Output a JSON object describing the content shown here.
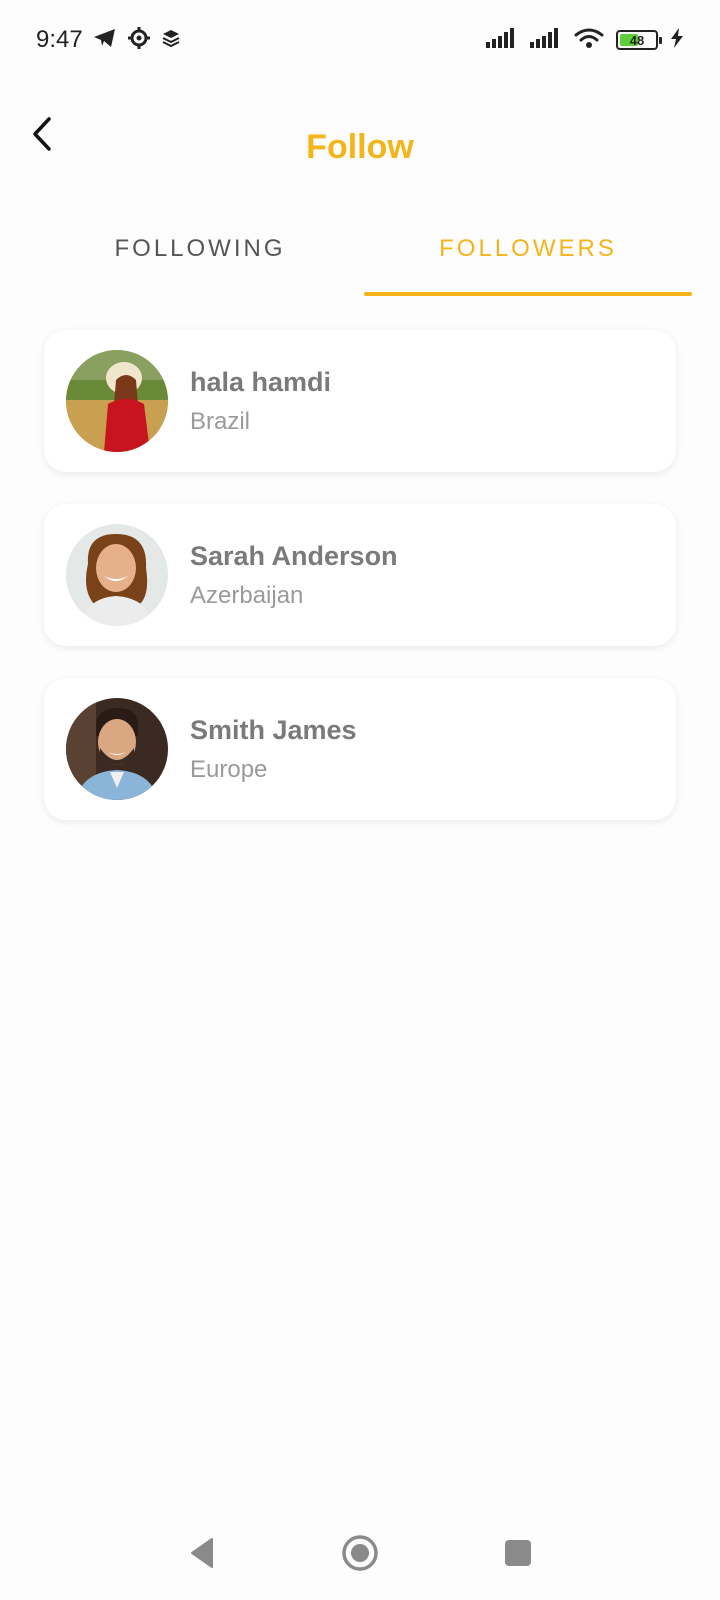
{
  "status_bar": {
    "time": "9:47",
    "battery_level": "48",
    "icons": [
      "telegram-icon",
      "settings-icon",
      "layers-icon",
      "signal-icon",
      "signal-icon",
      "wifi-icon",
      "battery-icon",
      "charging-icon"
    ]
  },
  "header": {
    "title": "Follow",
    "back_icon": "chevron-left-icon"
  },
  "tabs": [
    {
      "label": "FOLLOWING",
      "active": false
    },
    {
      "label": "FOLLOWERS",
      "active": true
    }
  ],
  "followers": [
    {
      "name": "hala hamdi",
      "location": "Brazil"
    },
    {
      "name": "Sarah Anderson",
      "location": "Azerbaijan"
    },
    {
      "name": "Smith James",
      "location": "Europe"
    }
  ],
  "nav_bar": {
    "buttons": [
      "back-triangle-icon",
      "home-circle-icon",
      "recents-square-icon"
    ]
  },
  "colors": {
    "accent": "#f4b41a",
    "name_text": "#7a7a7a",
    "location_text": "#9a9a9a",
    "background": "#fdfdfd"
  }
}
